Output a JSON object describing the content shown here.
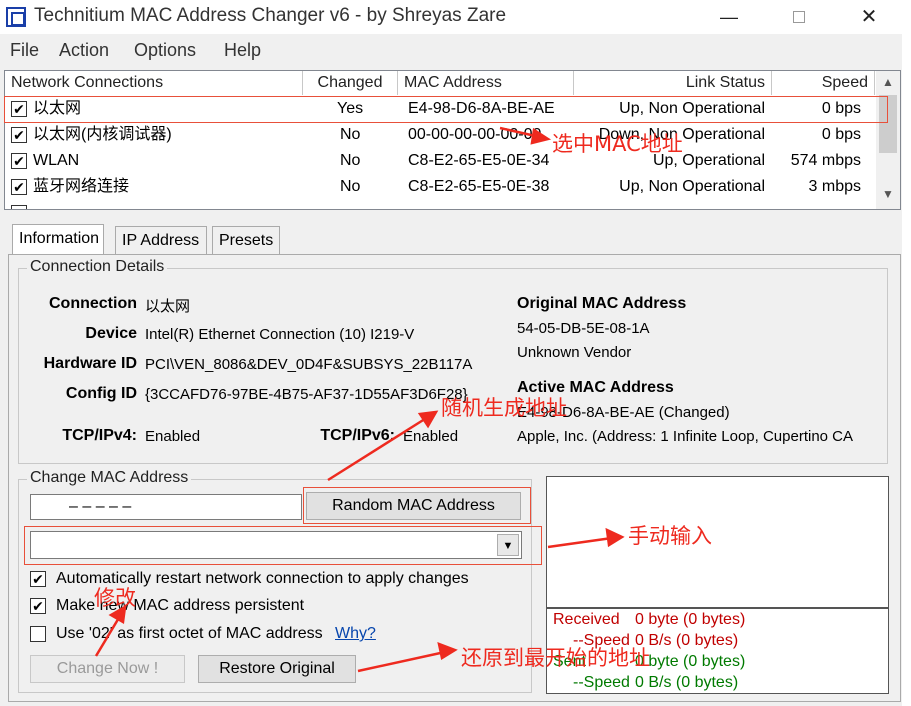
{
  "window": {
    "title": "Technitium MAC Address Changer v6 - by Shreyas Zare",
    "minimize": "—",
    "close": "✕"
  },
  "menu": [
    "File",
    "Action",
    "Options",
    "Help"
  ],
  "list": {
    "headers": [
      "Network Connections",
      "Changed",
      "MAC Address",
      "Link Status",
      "Speed"
    ],
    "rows": [
      {
        "name": "以太网",
        "changed": "Yes",
        "mac": "E4-98-D6-8A-BE-AE",
        "status": "Up, Non Operational",
        "speed": "0 bps",
        "checked": "✔"
      },
      {
        "name": "以太网(内核调试器)",
        "changed": "No",
        "mac": "00-00-00-00-00-00",
        "status": "Down, Non Operational",
        "speed": "0 bps",
        "checked": "✔"
      },
      {
        "name": "WLAN",
        "changed": "No",
        "mac": "C8-E2-65-E5-0E-34",
        "status": "Up, Operational",
        "speed": "574 mbps",
        "checked": "✔"
      },
      {
        "name": "蓝牙网络连接",
        "changed": "No",
        "mac": "C8-E2-65-E5-0E-38",
        "status": "Up, Non Operational",
        "speed": "3 mbps",
        "checked": "✔"
      }
    ],
    "scroll_up": "▲",
    "scroll_down": "▼"
  },
  "tabs": [
    "Information",
    "IP Address",
    "Presets"
  ],
  "details": {
    "group_title": "Connection Details",
    "connection_label": "Connection",
    "connection_value": "以太网",
    "device_label": "Device",
    "device_value": "Intel(R) Ethernet Connection (10) I219-V",
    "hwid_label": "Hardware ID",
    "hwid_value": "PCI\\VEN_8086&DEV_0D4F&SUBSYS_22B117A",
    "config_label": "Config ID",
    "config_value": "{3CCAFD76-97BE-4B75-AF37-1D55AF3D6F28}",
    "tcp4_label": "TCP/IPv4:",
    "tcp4_value": "Enabled",
    "tcp6_label": "TCP/IPv6:",
    "tcp6_value": "Enabled",
    "orig_mac_title": "Original MAC Address",
    "orig_mac": "54-05-DB-5E-08-1A",
    "orig_vendor": "Unknown Vendor",
    "active_mac_title": "Active MAC Address",
    "active_mac": "E4-98-D6-8A-BE-AE (Changed)",
    "active_vendor": "Apple, Inc.  (Address: 1 Infinite Loop, Cupertino  CA"
  },
  "change": {
    "group_title": "Change MAC Address",
    "mac_segments": "–   –   –   –   –",
    "random_button": "Random MAC Address",
    "combo_arrow": "▼",
    "opt1": "Automatically restart network connection to apply changes",
    "opt2": "Make new MAC address persistent",
    "opt3": "Use '02' as first octet of MAC address",
    "why": "Why?",
    "check_mark": "✔",
    "change_now": "Change Now !",
    "restore": "Restore Original"
  },
  "stats": {
    "received_label": "Received",
    "received_value": "0 byte (0 bytes)",
    "rspeed_label": "--Speed",
    "rspeed_value": "0 B/s (0 bytes)",
    "sent_label": "Sent",
    "sent_value": "0 byte (0 bytes)",
    "sspeed_label": "--Speed",
    "sspeed_value": "0 B/s (0 bytes)",
    "received_color": "#c00000",
    "sent_color": "#007a00"
  },
  "annotations": {
    "select_mac": "选中MAC地址",
    "random_gen": "随机生成地址",
    "manual_input": "手动输入",
    "modify": "修改",
    "restore_orig": "还原到最开始的地址",
    "color": "#ee2a1f"
  }
}
